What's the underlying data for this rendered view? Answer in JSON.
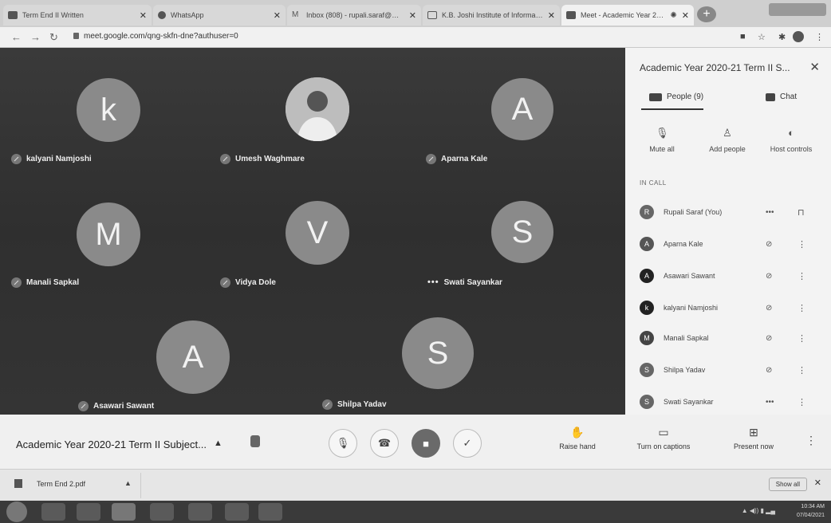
{
  "browser": {
    "tabs": [
      {
        "title": "Term End II Written",
        "active": false
      },
      {
        "title": "WhatsApp",
        "active": false
      },
      {
        "title": "Inbox (808) - rupali.saraf@mahav",
        "active": false
      },
      {
        "title": "K.B. Joshi Institute of Informatio",
        "active": false
      },
      {
        "title": "Meet - Academic Year 2020-",
        "active": true
      }
    ],
    "new_tab": "+",
    "url": "meet.google.com/qng-skfn-dne?authuser=0"
  },
  "stage": {
    "participants": [
      {
        "name": "kalyani Namjoshi",
        "initial": "k"
      },
      {
        "name": "Umesh Waghmare",
        "initial": ""
      },
      {
        "name": "Aparna Kale",
        "initial": "A"
      },
      {
        "name": "Manali Sapkal",
        "initial": "M"
      },
      {
        "name": "Vidya Dole",
        "initial": "V"
      },
      {
        "name": "Swati Sayankar",
        "initial": "S"
      },
      {
        "name": "Asawari Sawant",
        "initial": "A"
      },
      {
        "name": "Shilpa Yadav",
        "initial": "S"
      }
    ]
  },
  "panel": {
    "title": "Academic Year 2020-21 Term II S...",
    "tabs": {
      "people": "People (9)",
      "chat": "Chat"
    },
    "actions": {
      "mute_all": "Mute all",
      "add_people": "Add people",
      "host_controls": "Host controls"
    },
    "section": "IN CALL",
    "people": [
      {
        "initial": "R",
        "name": "Rupali Saraf (You)"
      },
      {
        "initial": "A",
        "name": "Aparna Kale"
      },
      {
        "initial": "A",
        "name": "Asawari Sawant"
      },
      {
        "initial": "k",
        "name": "kalyani Namjoshi"
      },
      {
        "initial": "M",
        "name": "Manali Sapkal"
      },
      {
        "initial": "S",
        "name": "Shilpa Yadav"
      },
      {
        "initial": "S",
        "name": "Swati Sayankar"
      }
    ]
  },
  "controls": {
    "meeting_title": "Academic Year 2020-21 Term II Subject...",
    "raise_hand": "Raise hand",
    "captions": "Turn on captions",
    "present": "Present now"
  },
  "downloads": {
    "file": "Term End 2.pdf",
    "show_all": "Show all"
  },
  "taskbar": {
    "time": "10:34 AM",
    "date": "07/04/2021"
  }
}
